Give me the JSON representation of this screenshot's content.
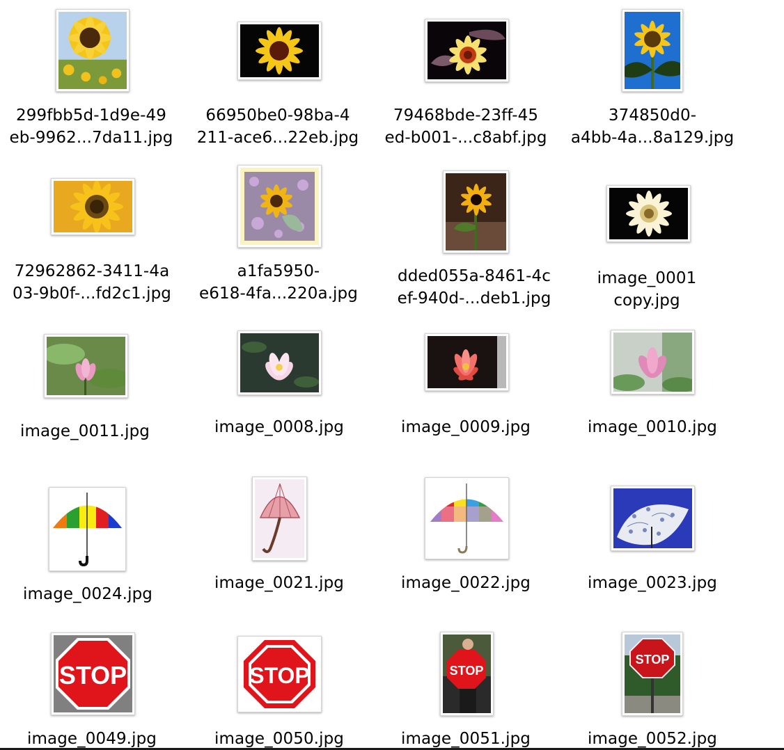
{
  "files": [
    {
      "name": "299fbb5d-1d9e-49\neb-9962...7da11.jpg",
      "thumbnail": "sunflower-field-icon"
    },
    {
      "name": "66950be0-98ba-4\n211-ace6...22eb.jpg",
      "thumbnail": "sunflower-black-bg-icon"
    },
    {
      "name": "79468bde-23ff-45\ned-b001-...c8abf.jpg",
      "thumbnail": "sunflower-dark-leaves-icon"
    },
    {
      "name": "374850d0-\na4bb-4a...8a129.jpg",
      "thumbnail": "sunflower-blue-sky-icon"
    },
    {
      "name": "72962862-3411-4a\n03-9b0f-...fd2c1.jpg",
      "thumbnail": "sunflower-closeup-icon"
    },
    {
      "name": "a1fa5950-\ne618-4fa...220a.jpg",
      "thumbnail": "sunflower-painting-icon"
    },
    {
      "name": "dded055a-8461-4c\nef-940d-...deb1.jpg",
      "thumbnail": "sunflower-garden-icon"
    },
    {
      "name": "image_0001\ncopy.jpg",
      "thumbnail": "sunflower-white-icon"
    },
    {
      "name": "image_0011.jpg",
      "thumbnail": "lotus-pond-icon"
    },
    {
      "name": "image_0008.jpg",
      "thumbnail": "lotus-dark-water-icon"
    },
    {
      "name": "image_0009.jpg",
      "thumbnail": "water-lily-red-icon"
    },
    {
      "name": "image_0010.jpg",
      "thumbnail": "lotus-pink-icon"
    },
    {
      "name": "image_0024.jpg",
      "thumbnail": "umbrella-rainbow-icon"
    },
    {
      "name": "image_0021.jpg",
      "thumbnail": "umbrella-pink-drawing-icon"
    },
    {
      "name": "image_0022.jpg",
      "thumbnail": "umbrella-patchwork-icon"
    },
    {
      "name": "image_0023.jpg",
      "thumbnail": "umbrella-blue-pattern-icon"
    },
    {
      "name": "image_0049.jpg",
      "thumbnail": "stop-sign-gray-bg-icon"
    },
    {
      "name": "image_0050.jpg",
      "thumbnail": "stop-sign-white-bg-icon"
    },
    {
      "name": "image_0051.jpg",
      "thumbnail": "stop-sign-person-icon"
    },
    {
      "name": "image_0052.jpg",
      "thumbnail": "stop-sign-street-icon"
    }
  ],
  "stop_text": "STOP",
  "colors": {
    "sunflower_petal": "#f5c518",
    "sunflower_center": "#4a2a0a",
    "stop_red": "#e0141b",
    "lotus_pink": "#f2a6c8",
    "leaf_green": "#5c8a3a"
  }
}
